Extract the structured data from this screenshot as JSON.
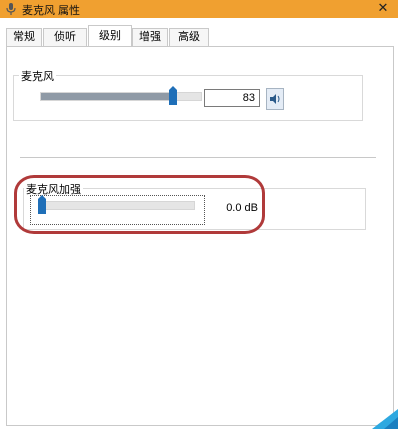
{
  "window": {
    "title": "麦克风 属性",
    "close_glyph": "✕"
  },
  "tabs": [
    {
      "label": "常规"
    },
    {
      "label": "侦听"
    },
    {
      "label": "级别",
      "active": true
    },
    {
      "label": "增强"
    },
    {
      "label": "高级"
    }
  ],
  "levels": {
    "microphone": {
      "label": "麦克风",
      "value": "83",
      "level_fraction": 0.83
    },
    "boost": {
      "label": "麦克风加强",
      "value": "0.0 dB",
      "level_fraction": 0.0
    }
  },
  "colors": {
    "titlebar": "#f0a030",
    "thumb": "#1f6fb8",
    "highlight": "#b03a3a"
  },
  "icons": {
    "window": "microphone-icon",
    "close": "close-icon",
    "speaker": "speaker-icon"
  }
}
